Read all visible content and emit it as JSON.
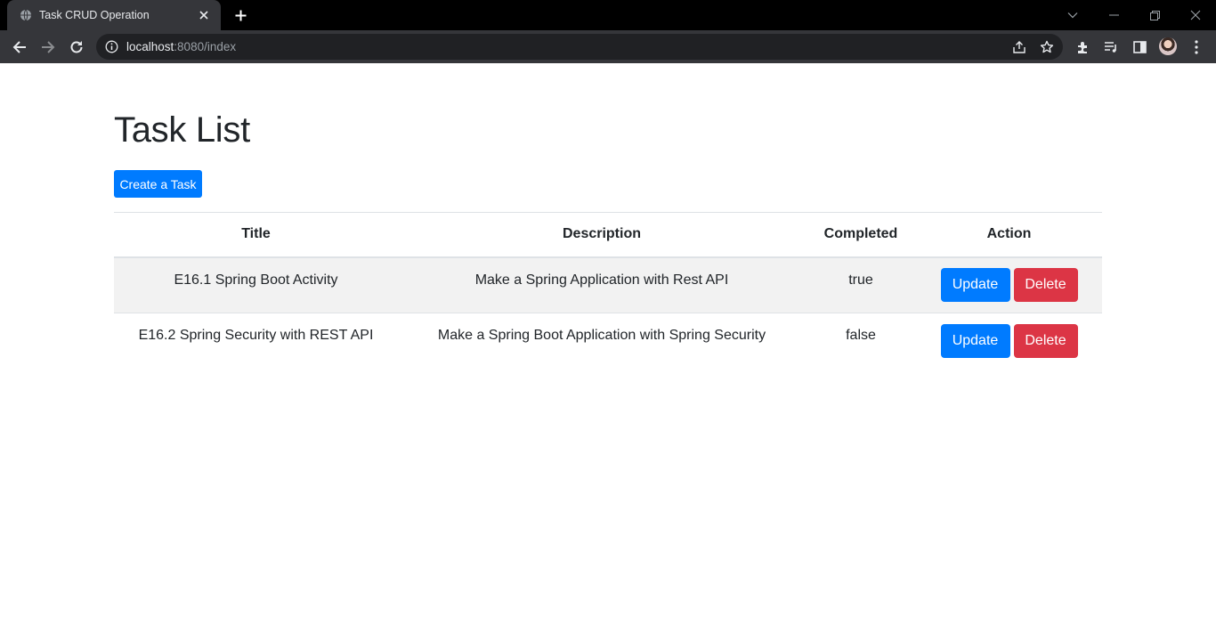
{
  "browser": {
    "tab_title": "Task CRUD Operation",
    "url_host": "localhost",
    "url_rest": ":8080/index",
    "colors": {
      "tabstrip": "#000000",
      "toolbar": "#35363a",
      "omnibox": "#202124"
    },
    "icons": [
      "globe-icon",
      "close-icon",
      "plus-icon",
      "chevron-down-icon",
      "minimize-icon",
      "restore-icon",
      "window-close-icon",
      "back-arrow-icon",
      "forward-arrow-icon",
      "reload-icon",
      "info-icon",
      "share-icon",
      "star-icon",
      "extensions-icon",
      "media-queue-icon",
      "side-panel-icon",
      "kebab-menu-icon"
    ]
  },
  "page": {
    "title": "Task List",
    "create_button": "Create a Task",
    "colors": {
      "primary": "#007bff",
      "danger": "#dc3545",
      "stripe": "#f2f2f2"
    }
  },
  "table": {
    "headers": [
      "Title",
      "Description",
      "Completed",
      "Action"
    ],
    "rows": [
      {
        "title": "E16.1 Spring Boot Activity",
        "description": "Make a Spring Application with Rest API",
        "completed": "true",
        "update_label": "Update",
        "delete_label": "Delete"
      },
      {
        "title": "E16.2 Spring Security with REST API",
        "description": "Make a Spring Boot Application with Spring Security",
        "completed": "false",
        "update_label": "Update",
        "delete_label": "Delete"
      }
    ]
  }
}
